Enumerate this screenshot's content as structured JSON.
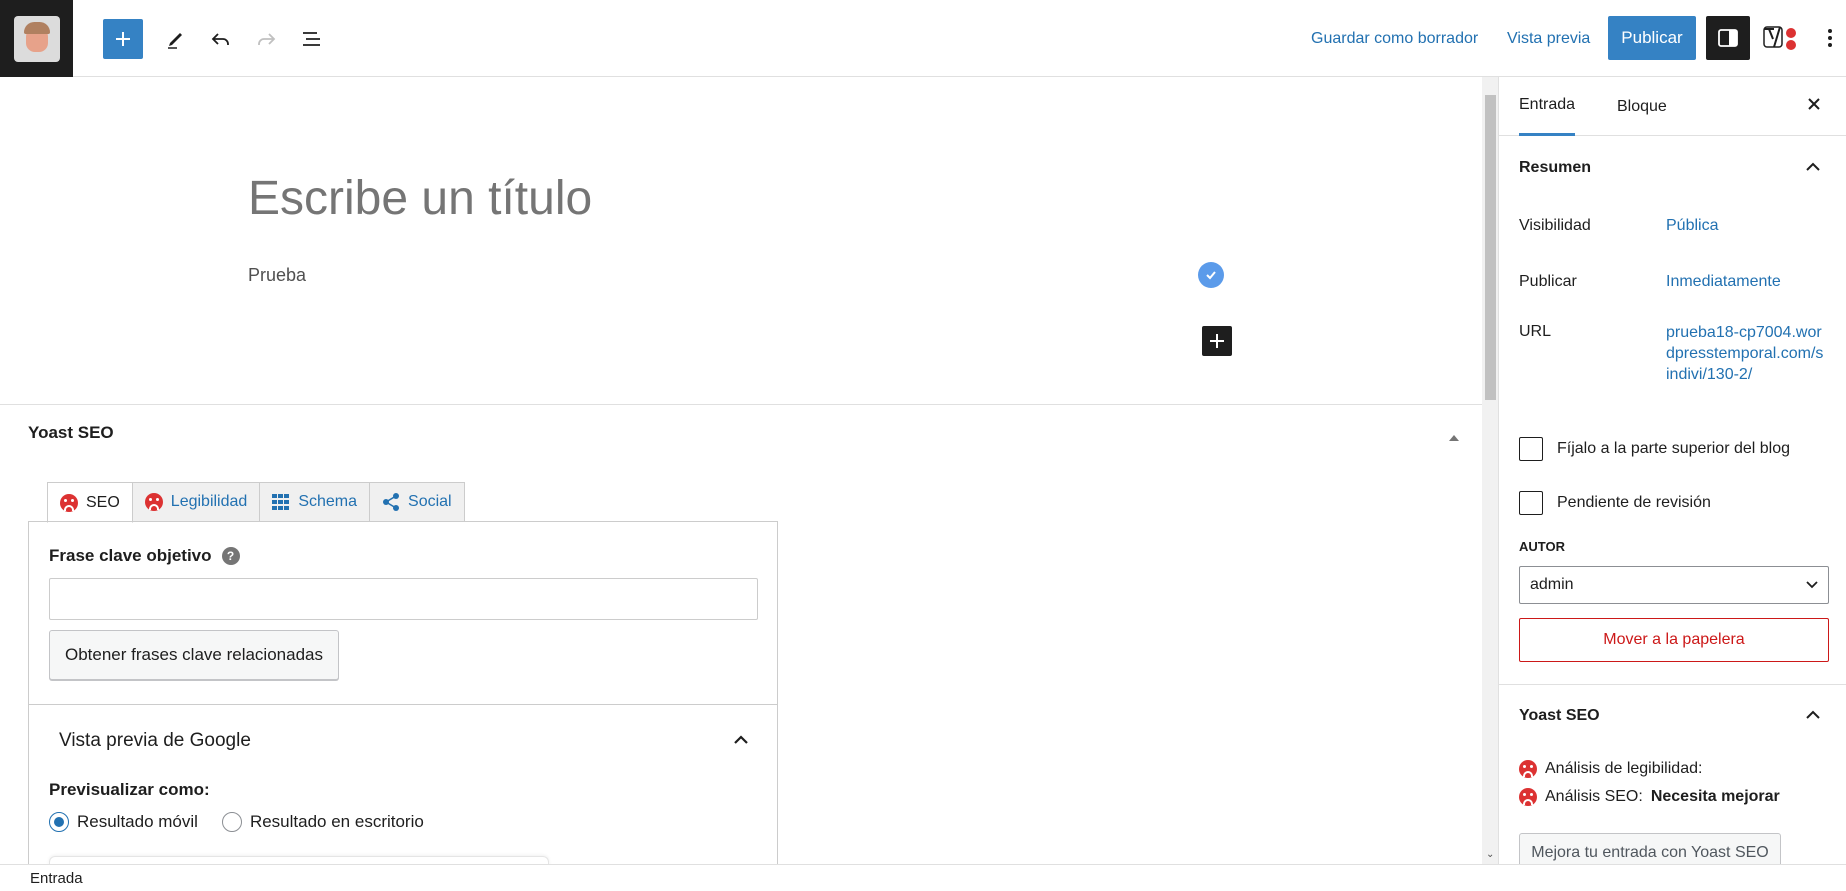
{
  "toolbar": {
    "save_draft": "Guardar como borrador",
    "preview": "Vista previa",
    "publish": "Publicar"
  },
  "editor": {
    "title_placeholder": "Escribe un título",
    "paragraph": "Prueba"
  },
  "yoast_metabox": {
    "title": "Yoast SEO",
    "tabs": [
      "SEO",
      "Legibilidad",
      "Schema",
      "Social"
    ],
    "focus_keyphrase_label": "Frase clave objetivo",
    "focus_keyphrase_value": "",
    "related_button": "Obtener frases clave relacionadas",
    "google_preview_title": "Vista previa de Google",
    "preview_as_label": "Previsualizar como:",
    "preview_options": [
      "Resultado móvil",
      "Resultado en escritorio"
    ],
    "preview_selected": "Resultado móvil"
  },
  "sidebar": {
    "tabs": [
      "Entrada",
      "Bloque"
    ],
    "active_tab": "Entrada",
    "summary": {
      "title": "Resumen",
      "visibility_label": "Visibilidad",
      "visibility_value": "Pública",
      "publish_label": "Publicar",
      "publish_value": "Inmediatamente",
      "url_label": "URL",
      "url_value": "prueba18-cp7004.wordpresstemporal.com/sindivi/130-2/",
      "sticky_label": "Fíjalo a la parte superior del blog",
      "pending_label": "Pendiente de revisión",
      "author_label": "AUTOR",
      "author_value": "admin",
      "trash_button": "Mover a la papelera"
    },
    "yoast": {
      "title": "Yoast SEO",
      "readability_label": "Análisis de legibilidad:",
      "seo_label": "Análisis SEO:",
      "seo_value": "Necesita mejorar",
      "improve_button": "Mejora tu entrada con Yoast SEO"
    }
  },
  "footer": {
    "breadcrumb": "Entrada"
  },
  "colors": {
    "accent": "#3582c4",
    "link": "#2271b1",
    "danger": "#cc1818",
    "yoast_bad": "#dc3232",
    "dark": "#1e1e1e"
  }
}
